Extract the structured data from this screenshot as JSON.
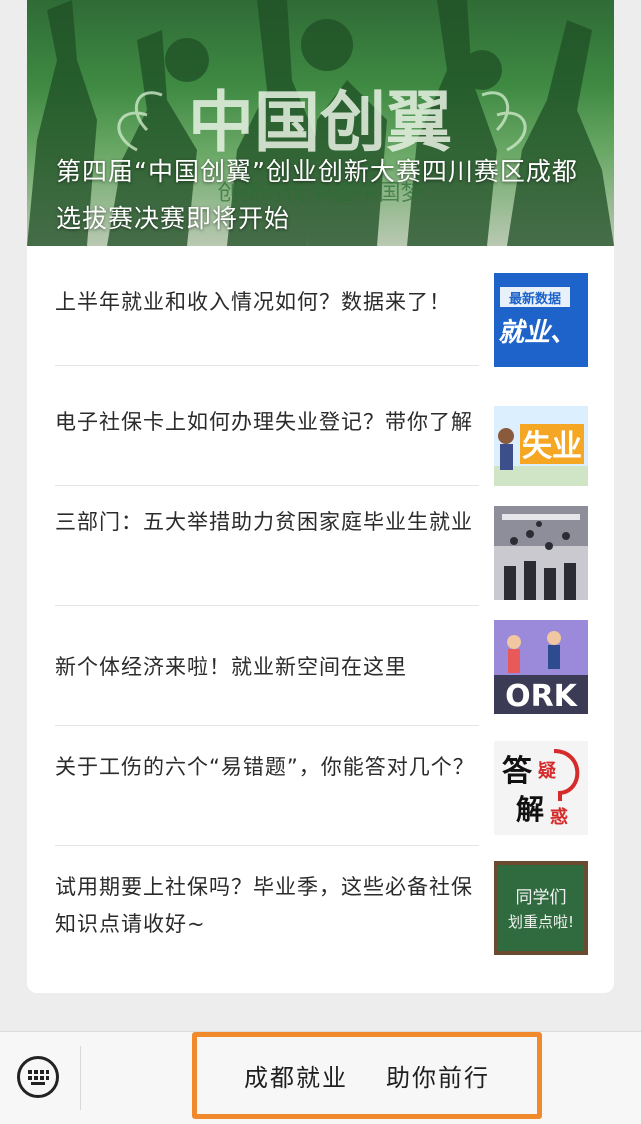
{
  "hero": {
    "title": "第四届“中国创翼”创业创新大赛四川赛区成都选拔赛决赛即将开始",
    "banner_text": "中国创翼",
    "banner_subtext": "创新时代 共圆中国梦"
  },
  "articles": [
    {
      "title": "上半年就业和收入情况如何？数据来了！",
      "thumb": {
        "label_top": "最新数据",
        "label_main": "就业、"
      }
    },
    {
      "title": "电子社保卡上如何办理失业登记？带你了解",
      "thumb": {
        "label_main": "失业"
      }
    },
    {
      "title": "三部门：五大举措助力贫困家庭毕业生就业",
      "thumb": {}
    },
    {
      "title": "新个体经济来啦！就业新空间在这里",
      "thumb": {
        "label_main": "ORK"
      }
    },
    {
      "title": "关于工伤的六个“易错题”，你能答对几个？",
      "thumb": {
        "label_a": "答",
        "label_b": "疑",
        "label_c": "解",
        "label_d": "惑"
      }
    },
    {
      "title": "试用期要上社保吗？毕业季，这些必备社保知识点请收好~",
      "thumb": {
        "label_line1": "同学们",
        "label_line2": "划重点啦!"
      }
    }
  ],
  "bottom_menu": {
    "items": [
      "成都就业",
      "助你前行"
    ],
    "highlight_color": "#f08a2c"
  },
  "icons": {
    "keyboard": "keyboard-icon"
  }
}
